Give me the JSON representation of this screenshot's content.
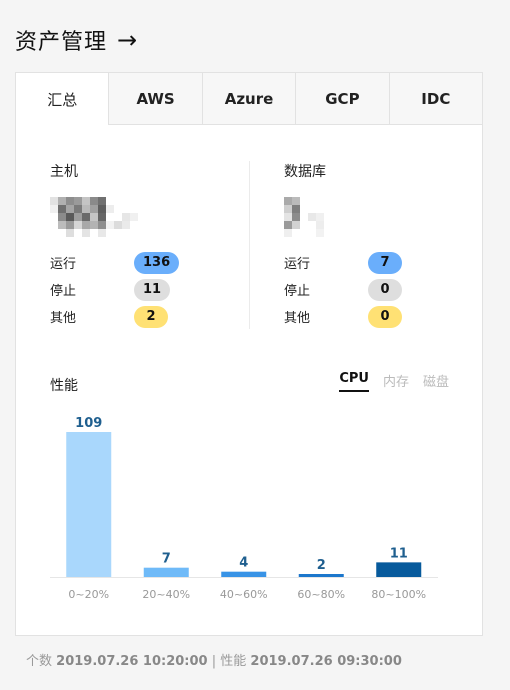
{
  "header": {
    "title": "资产管理",
    "arrow_icon": "arrow-right-icon"
  },
  "tabs": [
    {
      "label": "汇总",
      "active": true
    },
    {
      "label": "AWS",
      "active": false
    },
    {
      "label": "Azure",
      "active": false
    },
    {
      "label": "GCP",
      "active": false
    },
    {
      "label": "IDC",
      "active": false
    }
  ],
  "hosts": {
    "title": "主机",
    "rows": [
      {
        "label": "运行",
        "value": "136",
        "color": "#6aaefb"
      },
      {
        "label": "停止",
        "value": "11",
        "color": "#dedede"
      },
      {
        "label": "其他",
        "value": "2",
        "color": "#ffe174"
      }
    ]
  },
  "databases": {
    "title": "数据库",
    "rows": [
      {
        "label": "运行",
        "value": "7",
        "color": "#6aaefb"
      },
      {
        "label": "停止",
        "value": "0",
        "color": "#dedede"
      },
      {
        "label": "其他",
        "value": "0",
        "color": "#ffe174"
      }
    ]
  },
  "performance": {
    "title": "性能",
    "tabs": [
      {
        "label": "CPU",
        "active": true
      },
      {
        "label": "内存",
        "active": false
      },
      {
        "label": "磁盘",
        "active": false
      }
    ]
  },
  "chart_data": {
    "type": "bar",
    "categories": [
      "0~20%",
      "20~40%",
      "40~60%",
      "60~80%",
      "80~100%"
    ],
    "values": [
      109,
      7,
      4,
      2,
      11
    ],
    "colors": [
      "#a9d7fc",
      "#6fbaf8",
      "#3893e6",
      "#1c77cc",
      "#075a9c"
    ],
    "ylim": [
      0,
      109
    ]
  },
  "footer": {
    "count_label": "个数",
    "count_time": "2019.07.26 10:20:00",
    "separator": "|",
    "perf_label": "性能",
    "perf_time": "2019.07.26 09:30:00"
  }
}
